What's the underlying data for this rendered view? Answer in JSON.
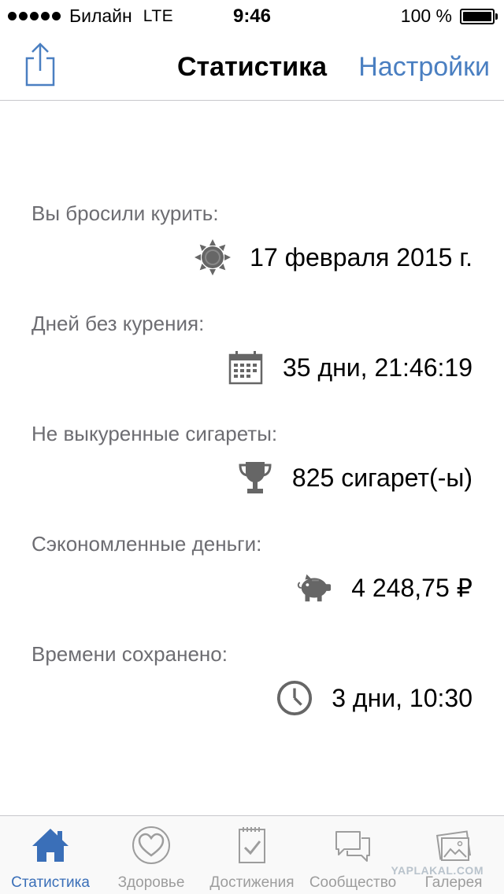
{
  "status_bar": {
    "carrier": "Билайн",
    "network": "LTE",
    "time": "9:46",
    "battery": "100 %"
  },
  "nav": {
    "title": "Статистика",
    "settings_label": "Настройки"
  },
  "stats": [
    {
      "label": "Вы бросили курить:",
      "value": "17 февраля 2015 г.",
      "icon": "sun-icon"
    },
    {
      "label": "Дней без курения:",
      "value": "35 дни, 21:46:19",
      "icon": "calendar-icon"
    },
    {
      "label": "Не выкуренные сигареты:",
      "value": "825 сигарет(-ы)",
      "icon": "trophy-icon"
    },
    {
      "label": "Сэкономленные деньги:",
      "value": "4 248,75 ₽",
      "icon": "piggy-bank-icon"
    },
    {
      "label": "Времени сохранено:",
      "value": "3 дни, 10:30",
      "icon": "clock-icon"
    }
  ],
  "tabs": [
    {
      "label": "Статистика",
      "icon": "home-icon",
      "active": true
    },
    {
      "label": "Здоровье",
      "icon": "heart-icon",
      "active": false
    },
    {
      "label": "Достижения",
      "icon": "notepad-check-icon",
      "active": false
    },
    {
      "label": "Сообщество",
      "icon": "chat-bubbles-icon",
      "active": false
    },
    {
      "label": "Галерея",
      "icon": "gallery-icon",
      "active": false
    }
  ],
  "watermark": "YAPLAKAL.COM",
  "colors": {
    "accent": "#4a7fc1",
    "active_tab": "#3a6fb8",
    "icon_gray": "#666666",
    "label_gray": "#6d6d72"
  }
}
